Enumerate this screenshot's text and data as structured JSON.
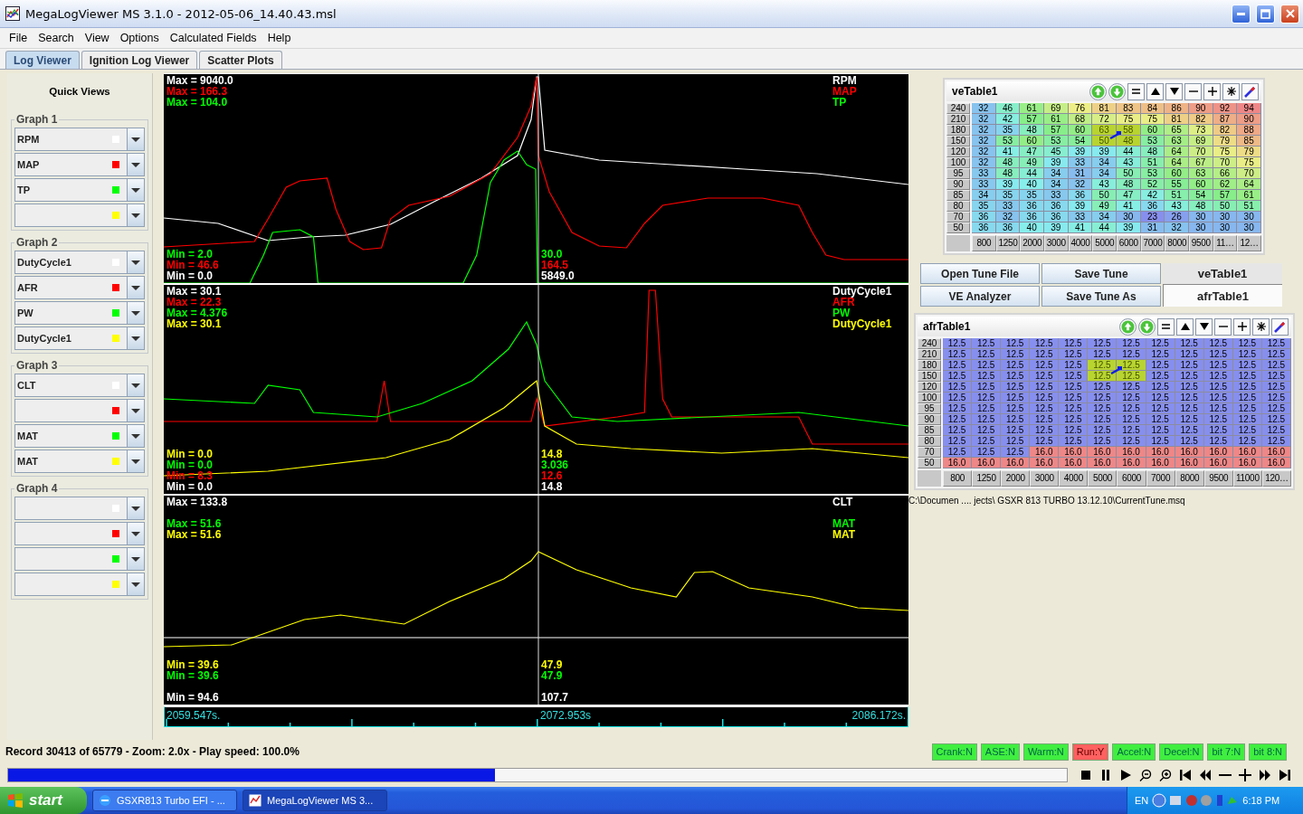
{
  "window": {
    "title": "MegaLogViewer MS 3.1.0 - 2012-05-06_14.40.43.msl"
  },
  "menu": [
    "File",
    "Search",
    "View",
    "Options",
    "Calculated Fields",
    "Help"
  ],
  "tabs": [
    {
      "label": "Log Viewer",
      "selected": true
    },
    {
      "label": "Ignition Log Viewer",
      "selected": false
    },
    {
      "label": "Scatter Plots",
      "selected": false
    }
  ],
  "quick_views": {
    "title": "Quick Views",
    "groups": [
      {
        "title": "Graph 1",
        "slots": [
          {
            "field": "RPM",
            "color": "#ffffff"
          },
          {
            "field": "MAP",
            "color": "#ff0000"
          },
          {
            "field": "TP",
            "color": "#00ff00"
          },
          {
            "color": "#ffff00"
          }
        ]
      },
      {
        "title": "Graph 2",
        "slots": [
          {
            "field": "DutyCycle1",
            "color": "#ffffff"
          },
          {
            "field": "AFR",
            "color": "#ff0000"
          },
          {
            "field": "PW",
            "color": "#00ff00"
          },
          {
            "field": "DutyCycle1",
            "color": "#ffff00"
          }
        ]
      },
      {
        "title": "Graph 3",
        "slots": [
          {
            "field": "CLT",
            "color": "#ffffff"
          },
          {
            "color": "#ff0000"
          },
          {
            "field": "MAT",
            "color": "#00ff00"
          },
          {
            "field": "MAT",
            "color": "#ffff00"
          }
        ]
      },
      {
        "title": "Graph 4",
        "slots": [
          {
            "color": "#ffffff"
          },
          {
            "color": "#ff0000"
          },
          {
            "color": "#00ff00"
          },
          {
            "color": "#ffff00"
          }
        ]
      }
    ]
  },
  "graphs": [
    {
      "max": [
        {
          "text": "Max = 9040.0",
          "color": "#ffffff"
        },
        {
          "text": "Max = 166.3",
          "color": "#ff0000"
        },
        {
          "text": "Max = 104.0",
          "color": "#00ff00"
        }
      ],
      "legend": [
        {
          "text": "RPM",
          "color": "#ffffff"
        },
        {
          "text": "MAP",
          "color": "#ff0000"
        },
        {
          "text": "TP",
          "color": "#00ff00"
        }
      ],
      "min": [
        {
          "text": "Min = 2.0",
          "color": "#00ff00"
        },
        {
          "text": "Min = 46.6",
          "color": "#ff0000"
        },
        {
          "text": "Min = 0.0",
          "color": "#ffffff"
        }
      ],
      "cursor": [
        {
          "text": "30.0",
          "color": "#00ff00"
        },
        {
          "text": "164.5",
          "color": "#ff0000"
        },
        {
          "text": "5849.0",
          "color": "#ffffff"
        }
      ]
    },
    {
      "max": [
        {
          "text": "Max = 30.1",
          "color": "#ffffff"
        },
        {
          "text": "Max = 22.3",
          "color": "#ff0000"
        },
        {
          "text": "Max = 4.376",
          "color": "#00ff00"
        },
        {
          "text": "Max = 30.1",
          "color": "#ffff00"
        }
      ],
      "legend": [
        {
          "text": "DutyCycle1",
          "color": "#ffffff"
        },
        {
          "text": "AFR",
          "color": "#ff0000"
        },
        {
          "text": "PW",
          "color": "#00ff00"
        },
        {
          "text": "DutyCycle1",
          "color": "#ffff00"
        }
      ],
      "min": [
        {
          "text": "Min = 0.0",
          "color": "#ffff00"
        },
        {
          "text": "Min = 0.0",
          "color": "#00ff00"
        },
        {
          "text": "Min = 8.3",
          "color": "#ff0000"
        },
        {
          "text": "Min = 0.0",
          "color": "#ffffff"
        }
      ],
      "cursor": [
        {
          "text": "14.8",
          "color": "#ffff00"
        },
        {
          "text": "3.036",
          "color": "#00ff00"
        },
        {
          "text": "12.6",
          "color": "#ff0000"
        },
        {
          "text": "14.8",
          "color": "#ffffff"
        }
      ]
    },
    {
      "max": [
        {
          "text": "Max = 133.8",
          "color": "#ffffff"
        },
        {
          "text": "Max = 51.6",
          "color": "#00ff00"
        },
        {
          "text": "Max = 51.6",
          "color": "#ffff00"
        }
      ],
      "legend": [
        {
          "text": "CLT",
          "color": "#ffffff"
        },
        {
          "text": "MAT",
          "color": "#00ff00"
        },
        {
          "text": "MAT",
          "color": "#ffff00"
        }
      ],
      "min": [
        {
          "text": "Min = 39.6",
          "color": "#ffff00"
        },
        {
          "text": "Min = 39.6",
          "color": "#00ff00"
        },
        {
          "text": "Min = 94.6",
          "color": "#ffffff"
        }
      ],
      "cursor": [
        {
          "text": "47.9",
          "color": "#ffff00"
        },
        {
          "text": "47.9",
          "color": "#00ff00"
        },
        {
          "text": "107.7",
          "color": "#ffffff"
        }
      ]
    }
  ],
  "time_axis": {
    "start": "2059.547s.",
    "cursor": "2072.953s",
    "end": "2086.172s."
  },
  "ve_table": {
    "title": "veTable1",
    "rows": [
      {
        "label": "240",
        "cells": [
          {
            "value": "32",
            "selected": false
          },
          {
            "value": "46",
            "selected": false
          },
          {
            "value": "61",
            "selected": false
          },
          {
            "value": "69",
            "selected": false
          },
          {
            "value": "76",
            "selected": false
          },
          {
            "value": "81",
            "selected": false
          },
          {
            "value": "83",
            "selected": false
          },
          {
            "value": "84",
            "selected": false
          },
          {
            "value": "86",
            "selected": false
          },
          {
            "value": "90",
            "selected": false
          },
          {
            "value": "92",
            "selected": false
          },
          {
            "value": "94",
            "selected": false
          }
        ]
      },
      {
        "label": "210",
        "cells": [
          {
            "value": "32",
            "selected": false
          },
          {
            "value": "42",
            "selected": false
          },
          {
            "value": "57",
            "selected": false
          },
          {
            "value": "61",
            "selected": false
          },
          {
            "value": "68",
            "selected": false
          },
          {
            "value": "72",
            "selected": false
          },
          {
            "value": "75",
            "selected": false
          },
          {
            "value": "75",
            "selected": false
          },
          {
            "value": "81",
            "selected": false
          },
          {
            "value": "82",
            "selected": false
          },
          {
            "value": "87",
            "selected": false
          },
          {
            "value": "90",
            "selected": false
          }
        ]
      },
      {
        "label": "180",
        "cells": [
          {
            "value": "32",
            "selected": false
          },
          {
            "value": "35",
            "selected": false
          },
          {
            "value": "48",
            "selected": false
          },
          {
            "value": "57",
            "selected": false
          },
          {
            "value": "60",
            "selected": false
          },
          {
            "value": "63",
            "selected": true
          },
          {
            "value": "58",
            "selected": true
          },
          {
            "value": "60",
            "selected": false
          },
          {
            "value": "65",
            "selected": false
          },
          {
            "value": "73",
            "selected": false
          },
          {
            "value": "82",
            "selected": false
          },
          {
            "value": "88",
            "selected": false
          }
        ]
      },
      {
        "label": "150",
        "cells": [
          {
            "value": "32",
            "selected": false
          },
          {
            "value": "53",
            "selected": false
          },
          {
            "value": "60",
            "selected": false
          },
          {
            "value": "53",
            "selected": false
          },
          {
            "value": "54",
            "selected": false
          },
          {
            "value": "50",
            "selected": true
          },
          {
            "value": "48",
            "selected": true
          },
          {
            "value": "53",
            "selected": false
          },
          {
            "value": "63",
            "selected": false
          },
          {
            "value": "69",
            "selected": false
          },
          {
            "value": "79",
            "selected": false
          },
          {
            "value": "85",
            "selected": false
          }
        ]
      },
      {
        "label": "120",
        "cells": [
          {
            "value": "32",
            "selected": false
          },
          {
            "value": "41",
            "selected": false
          },
          {
            "value": "47",
            "selected": false
          },
          {
            "value": "45",
            "selected": false
          },
          {
            "value": "39",
            "selected": false
          },
          {
            "value": "39",
            "selected": false
          },
          {
            "value": "44",
            "selected": false
          },
          {
            "value": "48",
            "selected": false
          },
          {
            "value": "64",
            "selected": false
          },
          {
            "value": "70",
            "selected": false
          },
          {
            "value": "75",
            "selected": false
          },
          {
            "value": "79",
            "selected": false
          }
        ]
      },
      {
        "label": "100",
        "cells": [
          {
            "value": "32",
            "selected": false
          },
          {
            "value": "48",
            "selected": false
          },
          {
            "value": "49",
            "selected": false
          },
          {
            "value": "39",
            "selected": false
          },
          {
            "value": "33",
            "selected": false
          },
          {
            "value": "34",
            "selected": false
          },
          {
            "value": "43",
            "selected": false
          },
          {
            "value": "51",
            "selected": false
          },
          {
            "value": "64",
            "selected": false
          },
          {
            "value": "67",
            "selected": false
          },
          {
            "value": "70",
            "selected": false
          },
          {
            "value": "75",
            "selected": false
          }
        ]
      },
      {
        "label": "95",
        "cells": [
          {
            "value": "33",
            "selected": false
          },
          {
            "value": "48",
            "selected": false
          },
          {
            "value": "44",
            "selected": false
          },
          {
            "value": "34",
            "selected": false
          },
          {
            "value": "31",
            "selected": false
          },
          {
            "value": "34",
            "selected": false
          },
          {
            "value": "50",
            "selected": false
          },
          {
            "value": "53",
            "selected": false
          },
          {
            "value": "60",
            "selected": false
          },
          {
            "value": "63",
            "selected": false
          },
          {
            "value": "66",
            "selected": false
          },
          {
            "value": "70",
            "selected": false
          }
        ]
      },
      {
        "label": "90",
        "cells": [
          {
            "value": "33",
            "selected": false
          },
          {
            "value": "39",
            "selected": false
          },
          {
            "value": "40",
            "selected": false
          },
          {
            "value": "34",
            "selected": false
          },
          {
            "value": "32",
            "selected": false
          },
          {
            "value": "43",
            "selected": false
          },
          {
            "value": "48",
            "selected": false
          },
          {
            "value": "52",
            "selected": false
          },
          {
            "value": "55",
            "selected": false
          },
          {
            "value": "60",
            "selected": false
          },
          {
            "value": "62",
            "selected": false
          },
          {
            "value": "64",
            "selected": false
          }
        ]
      },
      {
        "label": "85",
        "cells": [
          {
            "value": "34",
            "selected": false
          },
          {
            "value": "35",
            "selected": false
          },
          {
            "value": "35",
            "selected": false
          },
          {
            "value": "33",
            "selected": false
          },
          {
            "value": "36",
            "selected": false
          },
          {
            "value": "50",
            "selected": false
          },
          {
            "value": "47",
            "selected": false
          },
          {
            "value": "42",
            "selected": false
          },
          {
            "value": "51",
            "selected": false
          },
          {
            "value": "54",
            "selected": false
          },
          {
            "value": "57",
            "selected": false
          },
          {
            "value": "61",
            "selected": false
          }
        ]
      },
      {
        "label": "80",
        "cells": [
          {
            "value": "35",
            "selected": false
          },
          {
            "value": "33",
            "selected": false
          },
          {
            "value": "36",
            "selected": false
          },
          {
            "value": "36",
            "selected": false
          },
          {
            "value": "39",
            "selected": false
          },
          {
            "value": "49",
            "selected": false
          },
          {
            "value": "41",
            "selected": false
          },
          {
            "value": "36",
            "selected": false
          },
          {
            "value": "43",
            "selected": false
          },
          {
            "value": "48",
            "selected": false
          },
          {
            "value": "50",
            "selected": false
          },
          {
            "value": "51",
            "selected": false
          }
        ]
      },
      {
        "label": "70",
        "cells": [
          {
            "value": "36",
            "selected": false
          },
          {
            "value": "32",
            "selected": false
          },
          {
            "value": "36",
            "selected": false
          },
          {
            "value": "36",
            "selected": false
          },
          {
            "value": "33",
            "selected": false
          },
          {
            "value": "34",
            "selected": false
          },
          {
            "value": "30",
            "selected": false
          },
          {
            "value": "23",
            "selected": false
          },
          {
            "value": "26",
            "selected": false
          },
          {
            "value": "30",
            "selected": false
          },
          {
            "value": "30",
            "selected": false
          },
          {
            "value": "30",
            "selected": false
          }
        ]
      },
      {
        "label": "50",
        "cells": [
          {
            "value": "36",
            "selected": false
          },
          {
            "value": "36",
            "selected": false
          },
          {
            "value": "40",
            "selected": false
          },
          {
            "value": "39",
            "selected": false
          },
          {
            "value": "41",
            "selected": false
          },
          {
            "value": "44",
            "selected": false
          },
          {
            "value": "39",
            "selected": false
          },
          {
            "value": "31",
            "selected": false
          },
          {
            "value": "32",
            "selected": false
          },
          {
            "value": "30",
            "selected": false
          },
          {
            "value": "30",
            "selected": false
          },
          {
            "value": "30",
            "selected": false
          }
        ]
      }
    ],
    "x_axis_labels": [
      "800",
      "1250",
      "2000",
      "3000",
      "4000",
      "5000",
      "6000",
      "7000",
      "8000",
      "9500",
      "11…",
      "12…"
    ]
  },
  "tune_buttons": [
    "Open Tune File",
    "Save Tune",
    "VE Analyzer",
    "Save Tune As"
  ],
  "table_tabs": [
    {
      "label": "veTable1",
      "selected": false
    },
    {
      "label": "afrTable1",
      "selected": true
    }
  ],
  "afr_table": {
    "title": "afrTable1",
    "rows": [
      {
        "label": "240",
        "cells": [
          {
            "value": "12.5",
            "selected": false
          },
          {
            "value": "12.5",
            "selected": false
          },
          {
            "value": "12.5",
            "selected": false
          },
          {
            "value": "12.5",
            "selected": false
          },
          {
            "value": "12.5",
            "selected": false
          },
          {
            "value": "12.5",
            "selected": false
          },
          {
            "value": "12.5",
            "selected": false
          },
          {
            "value": "12.5",
            "selected": false
          },
          {
            "value": "12.5",
            "selected": false
          },
          {
            "value": "12.5",
            "selected": false
          },
          {
            "value": "12.5",
            "selected": false
          },
          {
            "value": "12.5",
            "selected": false
          }
        ]
      },
      {
        "label": "210",
        "cells": [
          {
            "value": "12.5",
            "selected": false
          },
          {
            "value": "12.5",
            "selected": false
          },
          {
            "value": "12.5",
            "selected": false
          },
          {
            "value": "12.5",
            "selected": false
          },
          {
            "value": "12.5",
            "selected": false
          },
          {
            "value": "12.5",
            "selected": false
          },
          {
            "value": "12.5",
            "selected": false
          },
          {
            "value": "12.5",
            "selected": false
          },
          {
            "value": "12.5",
            "selected": false
          },
          {
            "value": "12.5",
            "selected": false
          },
          {
            "value": "12.5",
            "selected": false
          },
          {
            "value": "12.5",
            "selected": false
          }
        ]
      },
      {
        "label": "180",
        "cells": [
          {
            "value": "12.5",
            "selected": false
          },
          {
            "value": "12.5",
            "selected": false
          },
          {
            "value": "12.5",
            "selected": false
          },
          {
            "value": "12.5",
            "selected": false
          },
          {
            "value": "12.5",
            "selected": false
          },
          {
            "value": "12.5",
            "selected": true
          },
          {
            "value": "12.5",
            "selected": true
          },
          {
            "value": "12.5",
            "selected": false
          },
          {
            "value": "12.5",
            "selected": false
          },
          {
            "value": "12.5",
            "selected": false
          },
          {
            "value": "12.5",
            "selected": false
          },
          {
            "value": "12.5",
            "selected": false
          }
        ]
      },
      {
        "label": "150",
        "cells": [
          {
            "value": "12.5",
            "selected": false
          },
          {
            "value": "12.5",
            "selected": false
          },
          {
            "value": "12.5",
            "selected": false
          },
          {
            "value": "12.5",
            "selected": false
          },
          {
            "value": "12.5",
            "selected": false
          },
          {
            "value": "12.5",
            "selected": true
          },
          {
            "value": "12.5",
            "selected": true
          },
          {
            "value": "12.5",
            "selected": false
          },
          {
            "value": "12.5",
            "selected": false
          },
          {
            "value": "12.5",
            "selected": false
          },
          {
            "value": "12.5",
            "selected": false
          },
          {
            "value": "12.5",
            "selected": false
          }
        ]
      },
      {
        "label": "120",
        "cells": [
          {
            "value": "12.5",
            "selected": false
          },
          {
            "value": "12.5",
            "selected": false
          },
          {
            "value": "12.5",
            "selected": false
          },
          {
            "value": "12.5",
            "selected": false
          },
          {
            "value": "12.5",
            "selected": false
          },
          {
            "value": "12.5",
            "selected": false
          },
          {
            "value": "12.5",
            "selected": false
          },
          {
            "value": "12.5",
            "selected": false
          },
          {
            "value": "12.5",
            "selected": false
          },
          {
            "value": "12.5",
            "selected": false
          },
          {
            "value": "12.5",
            "selected": false
          },
          {
            "value": "12.5",
            "selected": false
          }
        ]
      },
      {
        "label": "100",
        "cells": [
          {
            "value": "12.5",
            "selected": false
          },
          {
            "value": "12.5",
            "selected": false
          },
          {
            "value": "12.5",
            "selected": false
          },
          {
            "value": "12.5",
            "selected": false
          },
          {
            "value": "12.5",
            "selected": false
          },
          {
            "value": "12.5",
            "selected": false
          },
          {
            "value": "12.5",
            "selected": false
          },
          {
            "value": "12.5",
            "selected": false
          },
          {
            "value": "12.5",
            "selected": false
          },
          {
            "value": "12.5",
            "selected": false
          },
          {
            "value": "12.5",
            "selected": false
          },
          {
            "value": "12.5",
            "selected": false
          }
        ]
      },
      {
        "label": "95",
        "cells": [
          {
            "value": "12.5",
            "selected": false
          },
          {
            "value": "12.5",
            "selected": false
          },
          {
            "value": "12.5",
            "selected": false
          },
          {
            "value": "12.5",
            "selected": false
          },
          {
            "value": "12.5",
            "selected": false
          },
          {
            "value": "12.5",
            "selected": false
          },
          {
            "value": "12.5",
            "selected": false
          },
          {
            "value": "12.5",
            "selected": false
          },
          {
            "value": "12.5",
            "selected": false
          },
          {
            "value": "12.5",
            "selected": false
          },
          {
            "value": "12.5",
            "selected": false
          },
          {
            "value": "12.5",
            "selected": false
          }
        ]
      },
      {
        "label": "90",
        "cells": [
          {
            "value": "12.5",
            "selected": false
          },
          {
            "value": "12.5",
            "selected": false
          },
          {
            "value": "12.5",
            "selected": false
          },
          {
            "value": "12.5",
            "selected": false
          },
          {
            "value": "12.5",
            "selected": false
          },
          {
            "value": "12.5",
            "selected": false
          },
          {
            "value": "12.5",
            "selected": false
          },
          {
            "value": "12.5",
            "selected": false
          },
          {
            "value": "12.5",
            "selected": false
          },
          {
            "value": "12.5",
            "selected": false
          },
          {
            "value": "12.5",
            "selected": false
          },
          {
            "value": "12.5",
            "selected": false
          }
        ]
      },
      {
        "label": "85",
        "cells": [
          {
            "value": "12.5",
            "selected": false
          },
          {
            "value": "12.5",
            "selected": false
          },
          {
            "value": "12.5",
            "selected": false
          },
          {
            "value": "12.5",
            "selected": false
          },
          {
            "value": "12.5",
            "selected": false
          },
          {
            "value": "12.5",
            "selected": false
          },
          {
            "value": "12.5",
            "selected": false
          },
          {
            "value": "12.5",
            "selected": false
          },
          {
            "value": "12.5",
            "selected": false
          },
          {
            "value": "12.5",
            "selected": false
          },
          {
            "value": "12.5",
            "selected": false
          },
          {
            "value": "12.5",
            "selected": false
          }
        ]
      },
      {
        "label": "80",
        "cells": [
          {
            "value": "12.5",
            "selected": false
          },
          {
            "value": "12.5",
            "selected": false
          },
          {
            "value": "12.5",
            "selected": false
          },
          {
            "value": "12.5",
            "selected": false
          },
          {
            "value": "12.5",
            "selected": false
          },
          {
            "value": "12.5",
            "selected": false
          },
          {
            "value": "12.5",
            "selected": false
          },
          {
            "value": "12.5",
            "selected": false
          },
          {
            "value": "12.5",
            "selected": false
          },
          {
            "value": "12.5",
            "selected": false
          },
          {
            "value": "12.5",
            "selected": false
          },
          {
            "value": "12.5",
            "selected": false
          }
        ]
      },
      {
        "label": "70",
        "cells": [
          {
            "value": "12.5",
            "selected": false
          },
          {
            "value": "12.5",
            "selected": false
          },
          {
            "value": "12.5",
            "selected": false
          },
          {
            "value": "16.0",
            "selected": false
          },
          {
            "value": "16.0",
            "selected": false
          },
          {
            "value": "16.0",
            "selected": false
          },
          {
            "value": "16.0",
            "selected": false
          },
          {
            "value": "16.0",
            "selected": false
          },
          {
            "value": "16.0",
            "selected": false
          },
          {
            "value": "16.0",
            "selected": false
          },
          {
            "value": "16.0",
            "selected": false
          },
          {
            "value": "16.0",
            "selected": false
          }
        ]
      },
      {
        "label": "50",
        "cells": [
          {
            "value": "16.0",
            "selected": false
          },
          {
            "value": "16.0",
            "selected": false
          },
          {
            "value": "16.0",
            "selected": false
          },
          {
            "value": "16.0",
            "selected": false
          },
          {
            "value": "16.0",
            "selected": false
          },
          {
            "value": "16.0",
            "selected": false
          },
          {
            "value": "16.0",
            "selected": false
          },
          {
            "value": "16.0",
            "selected": false
          },
          {
            "value": "16.0",
            "selected": false
          },
          {
            "value": "16.0",
            "selected": false
          },
          {
            "value": "16.0",
            "selected": false
          },
          {
            "value": "16.0",
            "selected": false
          }
        ]
      }
    ],
    "x_axis_labels": [
      "800",
      "1250",
      "2000",
      "3000",
      "4000",
      "5000",
      "6000",
      "7000",
      "8000",
      "9500",
      "11000",
      "120…"
    ]
  },
  "tune_path": "C:\\Documen .... jects\\ GSXR 813 TURBO 13.12.10\\CurrentTune.msq",
  "status": {
    "record": "Record 30413 of 65779 - Zoom: 2.0x - Play speed: 100.0%",
    "flags": [
      {
        "label": "Crank:N",
        "on": false
      },
      {
        "label": "ASE:N",
        "on": false
      },
      {
        "label": "Warm:N",
        "on": false
      },
      {
        "label": "Run:Y",
        "on": true
      },
      {
        "label": "Accel:N",
        "on": false
      },
      {
        "label": "Decel:N",
        "on": false
      },
      {
        "label": "bit 7:N",
        "on": false
      },
      {
        "label": "bit 8:N",
        "on": false
      }
    ]
  },
  "playback": {
    "level": 0.46
  },
  "taskbar": {
    "start": "start",
    "tasks": [
      {
        "label": "GSXR813 Turbo EFI - ...",
        "selected": false
      },
      {
        "label": "MegaLogViewer MS 3...",
        "selected": true
      }
    ],
    "language": "EN",
    "time": "6:18 PM"
  }
}
